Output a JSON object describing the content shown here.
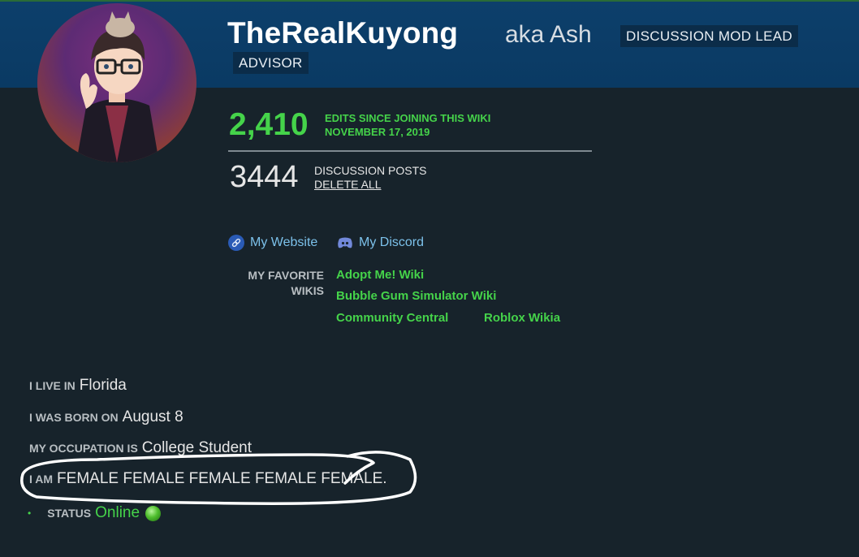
{
  "profile": {
    "username": "TheRealKuyong",
    "aka": "aka Ash",
    "tags": [
      "DISCUSSION MOD LEAD",
      "ADVISOR"
    ]
  },
  "stats": {
    "edits_count": "2,410",
    "edits_label_line1": "EDITS SINCE JOINING THIS WIKI",
    "edits_label_line2": "NOVEMBER 17, 2019",
    "posts_count": "3444",
    "posts_label": "DISCUSSION POSTS",
    "delete_all": "DELETE ALL"
  },
  "links": {
    "website": "My Website",
    "discord": "My Discord"
  },
  "favorites": {
    "label_line1": "MY FAVORITE",
    "label_line2": "WIKIS",
    "wikis": [
      "Adopt Me! Wiki",
      "Bubble Gum Simulator Wiki",
      "Community Central",
      "Roblox Wikia"
    ]
  },
  "info": {
    "live_key": "I LIVE IN",
    "live_val": "Florida",
    "born_key": "I WAS BORN ON",
    "born_val": "August 8",
    "occupation_key": "MY OCCUPATION IS",
    "occupation_val": "College Student",
    "iam_key": "I AM",
    "iam_val": "FEMALE FEMALE FEMALE FEMALE FEMALE.",
    "status_key": "STATUS",
    "status_val": "Online",
    "status_bullet": "•"
  },
  "colors": {
    "banner": "#0b3d66",
    "background": "#17232b",
    "accent_green": "#45d34a",
    "link_blue": "#7cc1ea"
  }
}
